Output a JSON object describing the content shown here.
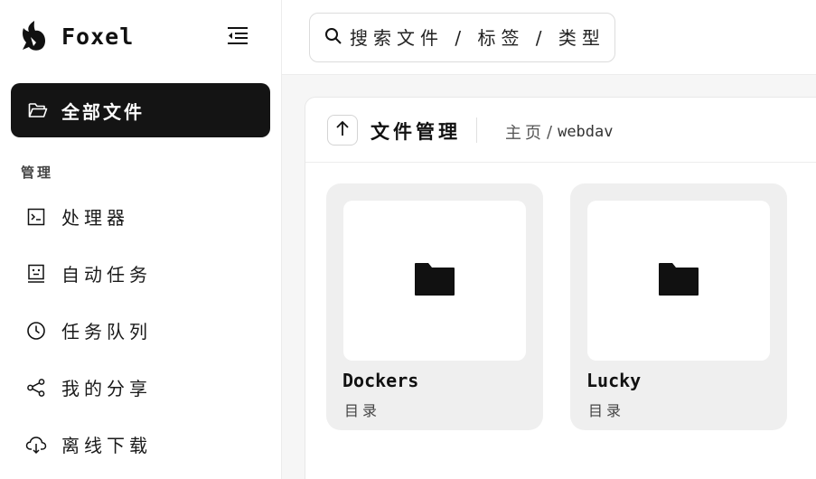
{
  "brand": {
    "name": "Foxel"
  },
  "sidebar": {
    "active_item": {
      "label": "全部文件",
      "icon": "folder-open-icon"
    },
    "section_label": "管理",
    "items": [
      {
        "label": "处理器",
        "icon": "terminal-icon"
      },
      {
        "label": "自动任务",
        "icon": "robot-icon"
      },
      {
        "label": "任务队列",
        "icon": "clock-icon"
      },
      {
        "label": "我的分享",
        "icon": "share-icon"
      },
      {
        "label": "离线下载",
        "icon": "cloud-download-icon"
      }
    ]
  },
  "search": {
    "placeholder": "搜索文件 / 标签 / 类型"
  },
  "panel": {
    "title": "文件管理",
    "breadcrumb": {
      "home": "主页",
      "separator": "/",
      "current": "webdav"
    }
  },
  "files": [
    {
      "name": "Dockers",
      "type": "目录",
      "icon": "folder-icon"
    },
    {
      "name": "Lucky",
      "type": "目录",
      "icon": "folder-icon"
    }
  ],
  "colors": {
    "active_bg": "#141414",
    "card_bg": "#efefef"
  }
}
